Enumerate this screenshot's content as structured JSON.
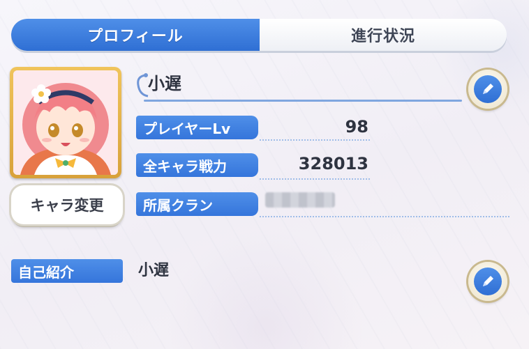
{
  "tabs": {
    "profile": "プロフィール",
    "progress": "進行状況"
  },
  "avatar": {
    "change_button": "キャラ変更"
  },
  "player": {
    "name": "小遅"
  },
  "stats": [
    {
      "label": "プレイヤーLv",
      "value": "98"
    },
    {
      "label": "全キャラ戦力",
      "value": "328013"
    },
    {
      "label": "所属クラン",
      "value": ""
    }
  ],
  "intro": {
    "label": "自己紹介",
    "text": "小遅"
  },
  "colors": {
    "accent_blue": "#3575db",
    "gold_frame": "#d8a13a"
  },
  "icons": {
    "edit": "pencil-icon"
  }
}
